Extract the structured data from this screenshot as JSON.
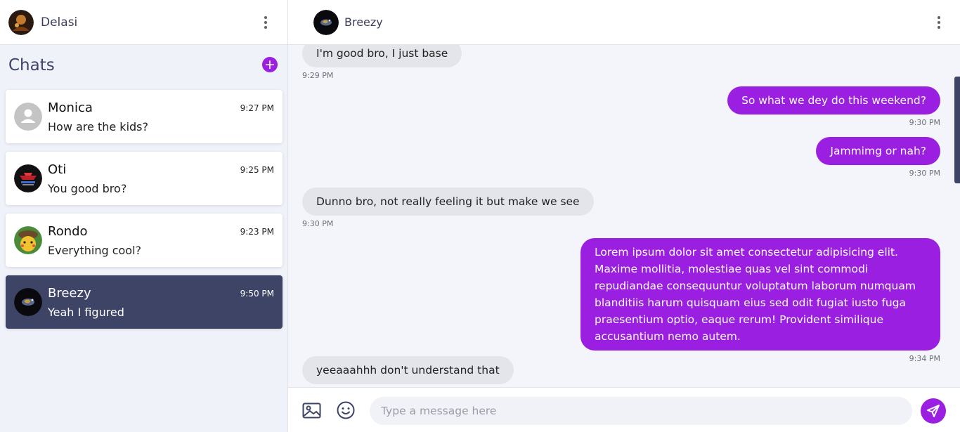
{
  "user": {
    "name": "Delasi"
  },
  "sidebar": {
    "title": "Chats",
    "new_chat_label": "+",
    "chats": [
      {
        "name": "Monica",
        "preview": "How are the kids?",
        "time": "9:27 PM"
      },
      {
        "name": "Oti",
        "preview": "You good bro?",
        "time": "9:25 PM"
      },
      {
        "name": "Rondo",
        "preview": "Everything cool?",
        "time": "9:23 PM"
      },
      {
        "name": "Breezy",
        "preview": "Yeah I figured",
        "time": "9:50 PM"
      }
    ]
  },
  "conversation": {
    "contact_name": "Breezy",
    "messages": [
      {
        "direction": "in",
        "text": "I'm good bro, I just base",
        "time": "9:29 PM"
      },
      {
        "direction": "out",
        "text": "So what we dey do this weekend?",
        "time": "9:30 PM"
      },
      {
        "direction": "out",
        "text": "Jammimg or nah?",
        "time": "9:30 PM"
      },
      {
        "direction": "in",
        "text": "Dunno bro, not really feeling it but make we see",
        "time": "9:30 PM"
      },
      {
        "direction": "out",
        "text": "Lorem ipsum dolor sit amet consectetur adipisicing elit. Maxime mollitia, molestiae quas vel sint commodi repudiandae consequuntur voluptatum laborum numquam blanditiis harum quisquam eius sed odit fugiat iusto fuga praesentium optio, eaque rerum! Provident similique accusantium nemo autem.",
        "time": "9:34 PM"
      },
      {
        "direction": "in",
        "text": "yeeaaahhh don't understand that",
        "time": ""
      }
    ]
  },
  "composer": {
    "placeholder": "Type a message here"
  },
  "colors": {
    "accent": "#9b1fe0",
    "active_chat": "#3d4466",
    "incoming_bubble": "#e4e5ea"
  }
}
